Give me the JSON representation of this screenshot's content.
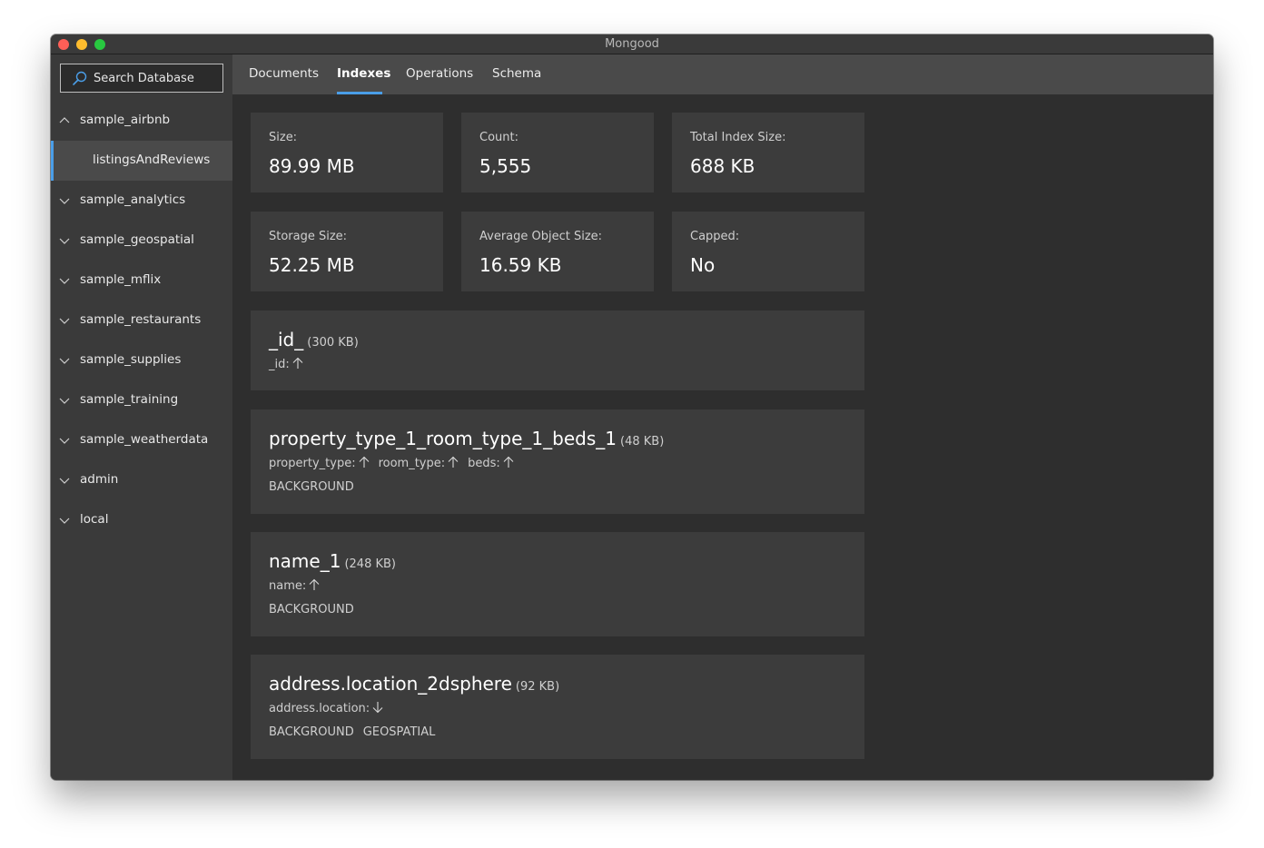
{
  "window": {
    "title": "Mongood"
  },
  "sidebar": {
    "search_placeholder": "Search Database",
    "databases": [
      {
        "name": "sample_airbnb",
        "expanded": true,
        "collections": [
          "listingsAndReviews"
        ]
      },
      {
        "name": "sample_analytics",
        "expanded": false
      },
      {
        "name": "sample_geospatial",
        "expanded": false
      },
      {
        "name": "sample_mflix",
        "expanded": false
      },
      {
        "name": "sample_restaurants",
        "expanded": false
      },
      {
        "name": "sample_supplies",
        "expanded": false
      },
      {
        "name": "sample_training",
        "expanded": false
      },
      {
        "name": "sample_weatherdata",
        "expanded": false
      },
      {
        "name": "admin",
        "expanded": false
      },
      {
        "name": "local",
        "expanded": false
      }
    ]
  },
  "tabs": [
    {
      "label": "Documents",
      "active": false
    },
    {
      "label": "Indexes",
      "active": true
    },
    {
      "label": "Operations",
      "active": false
    },
    {
      "label": "Schema",
      "active": false
    }
  ],
  "stats": [
    {
      "label": "Size:",
      "value": "89.99 MB"
    },
    {
      "label": "Count:",
      "value": "5,555"
    },
    {
      "label": "Total Index Size:",
      "value": "688 KB"
    },
    {
      "label": "Storage Size:",
      "value": "52.25 MB"
    },
    {
      "label": "Average Object Size:",
      "value": "16.59 KB"
    },
    {
      "label": "Capped:",
      "value": "No"
    }
  ],
  "indexes": [
    {
      "name": "_id_",
      "size": "(300 KB)",
      "keys": [
        {
          "field": "_id:",
          "direction": "asc"
        }
      ],
      "flags": []
    },
    {
      "name": "property_type_1_room_type_1_beds_1",
      "size": "(48 KB)",
      "keys": [
        {
          "field": "property_type:",
          "direction": "asc"
        },
        {
          "field": "room_type:",
          "direction": "asc"
        },
        {
          "field": "beds:",
          "direction": "asc"
        }
      ],
      "flags": [
        "BACKGROUND"
      ]
    },
    {
      "name": "name_1",
      "size": "(248 KB)",
      "keys": [
        {
          "field": "name:",
          "direction": "asc"
        }
      ],
      "flags": [
        "BACKGROUND"
      ]
    },
    {
      "name": "address.location_2dsphere",
      "size": "(92 KB)",
      "keys": [
        {
          "field": "address.location:",
          "direction": "desc"
        }
      ],
      "flags": [
        "BACKGROUND",
        "GEOSPATIAL"
      ]
    }
  ],
  "colors": {
    "accent": "#4a9ee8",
    "sidebar_bg": "#3a3a3a",
    "content_bg": "#2e2e2e",
    "card_bg": "#3c3c3c"
  }
}
